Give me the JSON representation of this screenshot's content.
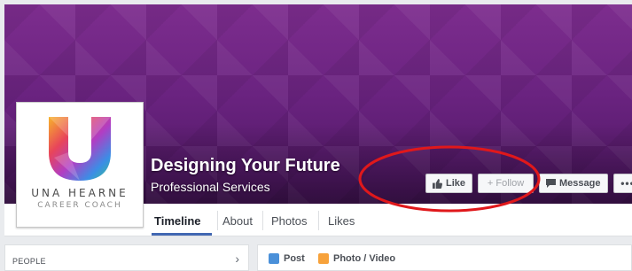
{
  "page": {
    "title": "Designing Your Future",
    "category": "Professional Services"
  },
  "profile": {
    "brand_name": "UNA HEARNE",
    "brand_sub": "CAREER COACH"
  },
  "actions": {
    "like_label": "Like",
    "follow_label": "+ Follow",
    "message_label": "Message",
    "more_label": "•••"
  },
  "tabs": [
    {
      "label": "Timeline"
    },
    {
      "label": "About"
    },
    {
      "label": "Photos"
    },
    {
      "label": "Likes"
    }
  ],
  "sidebar": {
    "people_label": "PEOPLE",
    "chevron": "›"
  },
  "composer": {
    "post_label": "Post",
    "photo_label": "Photo / Video"
  },
  "colors": {
    "cover": "#6a2380",
    "accent": "#4267b2",
    "annotation": "#e0181b"
  }
}
